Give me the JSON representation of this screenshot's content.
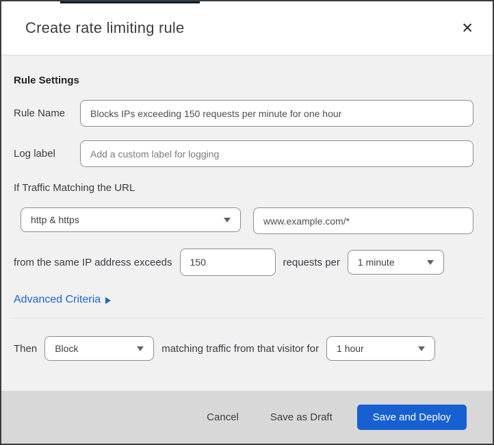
{
  "dialog": {
    "title": "Create rate limiting rule",
    "close_icon": "✕"
  },
  "rule_settings": {
    "heading": "Rule Settings",
    "rule_name": {
      "label": "Rule Name",
      "value": "Blocks IPs exceeding 150 requests per minute for one hour"
    },
    "log_label": {
      "label": "Log label",
      "placeholder": "Add a custom label for logging"
    }
  },
  "traffic_match": {
    "heading": "If Traffic Matching the URL",
    "scheme_select_value": "http & https",
    "url_value": "www.example.com/*",
    "threshold_prefix": "from the same IP address exceeds",
    "threshold_value": "150",
    "threshold_middle": "requests per",
    "period_select_value": "1 minute",
    "advanced_link": "Advanced Criteria"
  },
  "then_clause": {
    "label": "Then",
    "action_select_value": "Block",
    "middle_text": "matching traffic from that visitor for",
    "duration_select_value": "1 hour"
  },
  "footer": {
    "cancel_label": "Cancel",
    "save_draft_label": "Save as Draft",
    "save_deploy_label": "Save and Deploy"
  },
  "colors": {
    "primary_button_blue": "#1660d2",
    "link_blue": "#1a65cd",
    "body_background": "#f1f1f2",
    "footer_background": "#d8d8d8",
    "top_strip_navy": "#0c1e2d",
    "input_border_gray": "#8d8d8d"
  }
}
